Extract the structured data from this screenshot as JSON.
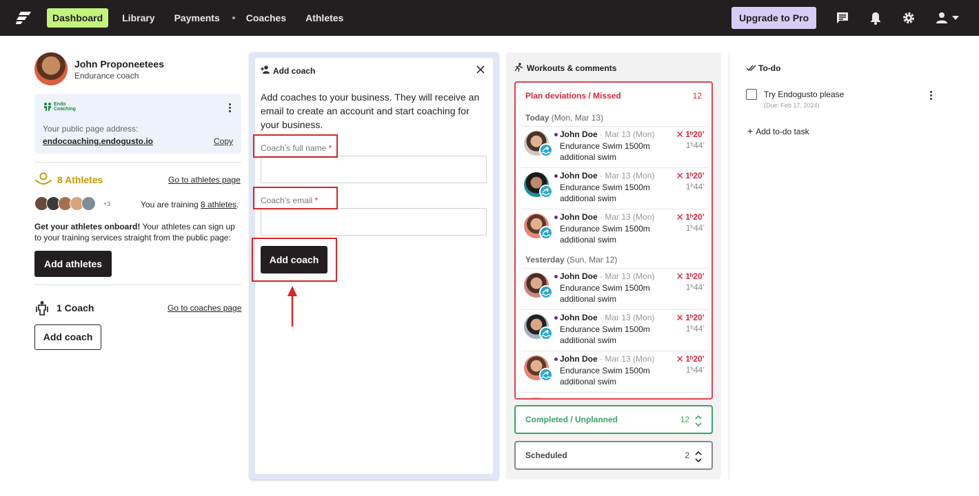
{
  "nav": {
    "items": [
      "Dashboard",
      "Library",
      "Payments",
      "Coaches",
      "Athletes"
    ],
    "upgrade": "Upgrade to Pro"
  },
  "profile": {
    "name": "John Proponeetees",
    "role": "Endurance coach"
  },
  "public_page": {
    "logo_text_1": "Endo",
    "logo_text_2": "Coaching",
    "label": "Your public page address:",
    "url": "endocoaching.endogusto.io",
    "copy": "Copy"
  },
  "athletes": {
    "title": "8 Athletes",
    "link": "Go to athletes page",
    "more": "+3",
    "training_prefix": "You are training ",
    "training_link": "8 athletes",
    "training_suffix": ".",
    "onboard_bold": "Get your athletes onboard!",
    "onboard_text": " Your athletes can sign up to your training services straight from the public page:",
    "button": "Add athletes"
  },
  "coaches": {
    "title": "1 Coach",
    "link": "Go to coaches page",
    "button": "Add coach"
  },
  "add_coach_panel": {
    "title": "Add coach",
    "description": "Add coaches to your business. They will receive an email to create an account and start coaching for your business.",
    "name_label": "Coach’s full name",
    "email_label": "Coach’s email",
    "required": "*",
    "submit": "Add coach"
  },
  "workouts": {
    "title": "Workouts & comments",
    "missed": {
      "label": "Plan deviations / Missed",
      "count": "12"
    },
    "today": {
      "day": "Today",
      "date": "(Mon, Mar 13)"
    },
    "yesterday": {
      "day": "Yesterday",
      "date": "(Sun, Mar 12)"
    },
    "rows": [
      {
        "name": "John Doe",
        "date": "· Mar 13 (Mon)",
        "desc": "Endurance Swim 1500m additional swim",
        "planned": "1ʰ20’",
        "actual": "1ʰ44’"
      },
      {
        "name": "John Doe",
        "date": "· Mar 13 (Mon)",
        "desc": "Endurance Swim 1500m additional swim",
        "planned": "1ʰ20’",
        "actual": "1ʰ44’"
      },
      {
        "name": "John Doe",
        "date": "· Mar 13 (Mon)",
        "desc": "Endurance Swim 1500m additional swim",
        "planned": "1ʰ20’",
        "actual": "1ʰ44’"
      },
      {
        "name": "John Doe",
        "date": "· Mar 13 (Mon)",
        "desc": "Endurance Swim 1500m additional swim",
        "planned": "1ʰ20’",
        "actual": "1ʰ44’"
      },
      {
        "name": "John Doe",
        "date": "· Mar 13 (Mon)",
        "desc": "Endurance Swim 1500m additional swim",
        "planned": "1ʰ20’",
        "actual": "1ʰ44’"
      },
      {
        "name": "John Doe",
        "date": "· Mar 13 (Mon)",
        "desc": "Endurance Swim 1500m additional swim",
        "planned": "1ʰ20’",
        "actual": "1ʰ44’"
      }
    ],
    "completed": {
      "label": "Completed / Unplanned",
      "count": "12"
    },
    "scheduled": {
      "label": "Scheduled",
      "count": "2"
    }
  },
  "todo": {
    "title": "To-do",
    "item": "Try Endogusto please",
    "due": "(Due: Feb 17, 2024)",
    "add": "Add to-do task"
  },
  "colors": {
    "accent_green": "#c5f27a",
    "upgrade_purple": "#d6ccf5",
    "missed_red": "#e0424f",
    "completed_green": "#3aa464",
    "annotation_red": "#d62828"
  }
}
